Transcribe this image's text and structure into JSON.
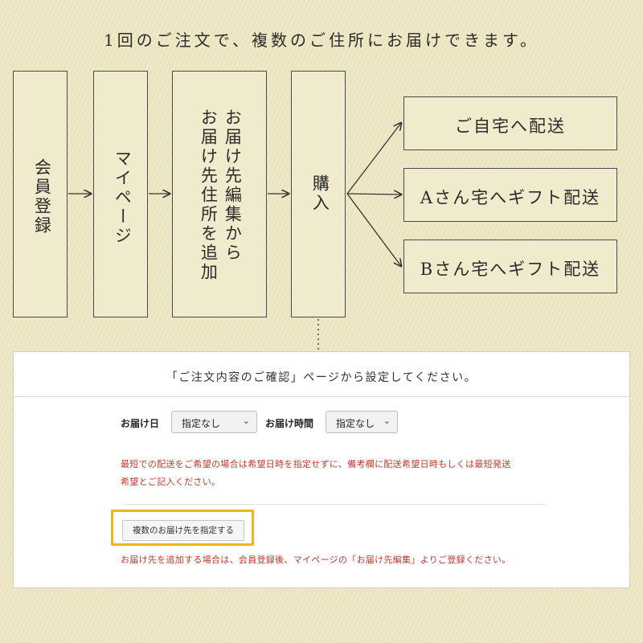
{
  "headline": "1回のご注文で、複数のご住所にお届けできます。",
  "flow": {
    "step1": "会員登録",
    "step2": "マイページ",
    "step3_line1": "お届け先編集から",
    "step3_line2": "お届け先住所を追加",
    "step4": "購入",
    "outcomes": [
      "ご自宅へ配送",
      "Aさん宅へギフト配送",
      "Bさん宅へギフト配送"
    ]
  },
  "panel": {
    "title": "「ご注文内容のご確認」ページから設定してください。",
    "delivery_date_label": "お届け日",
    "delivery_date_value": "指定なし",
    "delivery_time_label": "お届け時間",
    "delivery_time_value": "指定なし",
    "note_line1": "最短での配送をご希望の場合は希望日時を指定せずに、備考欄に配送希望日時もしくは最短発送",
    "note_line2": "希望とご記入ください。",
    "multi_address_button": "複数のお届け先を指定する",
    "add_address_note": "お届け先を追加する場合は、会員登録後、マイページの「お届け先編集」よりご登録ください。"
  },
  "colors": {
    "background": "#efe7c3",
    "note_red": "#c0392b",
    "highlight": "#f0b51a"
  }
}
